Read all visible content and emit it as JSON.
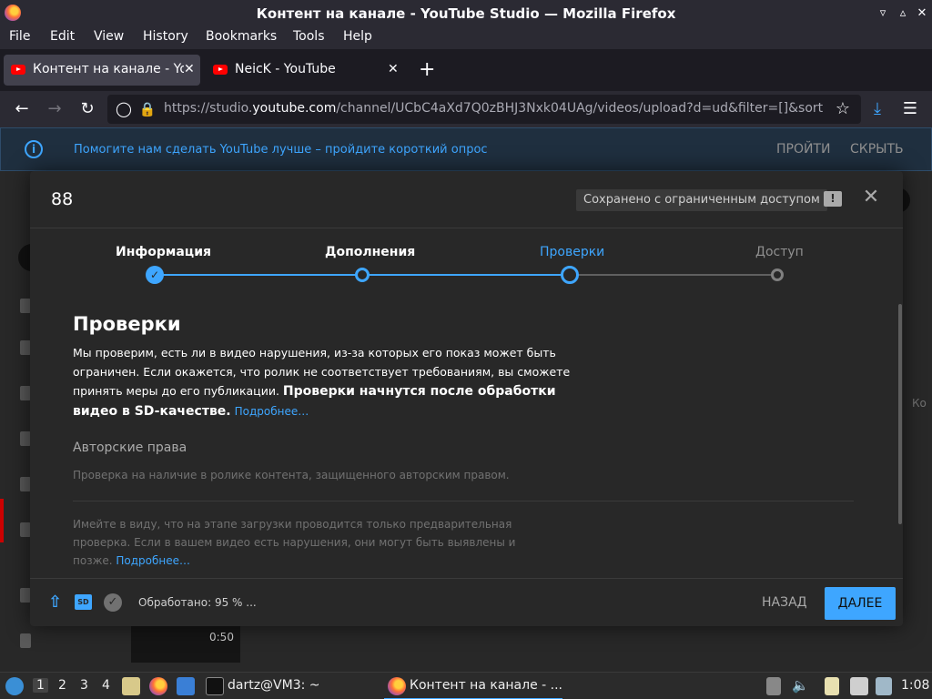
{
  "window": {
    "title": "Контент на канале - YouTube Studio — Mozilla Firefox"
  },
  "menubar": {
    "items": [
      "File",
      "Edit",
      "View",
      "History",
      "Bookmarks",
      "Tools",
      "Help"
    ]
  },
  "tabs": [
    {
      "label": "Контент на канале - You",
      "active": true
    },
    {
      "label": "NeicK - YouTube",
      "active": false
    }
  ],
  "navbar": {
    "url_prefix": "https://studio.",
    "url_host": "youtube.com",
    "url_rest": "/channel/UCbC4aXd7Q0zBHJ3Nxk04UAg/videos/upload?d=ud&filter=[]&sort"
  },
  "banner": {
    "text": "Помогите нам сделать YouTube лучше – пройдите короткий опрос",
    "go": "ПРОЙТИ",
    "hide": "СКРЫТЬ"
  },
  "dialog": {
    "title": "88",
    "saved_badge": "Сохранено с ограниченным доступом",
    "steps": [
      {
        "label": "Информация",
        "state": "done"
      },
      {
        "label": "Дополнения",
        "state": "done"
      },
      {
        "label": "Проверки",
        "state": "current"
      },
      {
        "label": "Доступ",
        "state": "pending"
      }
    ],
    "heading": "Проверки",
    "para_normal": "Мы проверим, есть ли в видео нарушения, из-за которых его показ может быть ограничен. Если окажется, что ролик не соответствует требованиям, вы сможете принять меры до его публикации. ",
    "para_bold": "Проверки начнутся после обработки видео в SD-качестве.",
    "para_link": "Подробнее…",
    "copyright_title": "Авторские права",
    "copyright_desc": "Проверка на наличие в ролике контента, защищенного авторским правом.",
    "note_text": "Имейте в виду, что на этапе загрузки проводится только предварительная проверка. Если в вашем видео есть нарушения, они могут быть выявлены и позже. ",
    "note_link": "Подробнее…",
    "footer_status": "Обработано: 95 % ...",
    "back_label": "НАЗАД",
    "next_label": "ДАЛЕЕ"
  },
  "background": {
    "duration": "0:50",
    "edge_text": "Ко"
  },
  "taskbar": {
    "workspaces": [
      "1",
      "2",
      "3",
      "4"
    ],
    "terminal_label": "dartz@VM3: ~",
    "firefox_task": "Контент на канале - ...",
    "clock": "1:08"
  },
  "colors": {
    "accent": "#3ea6ff",
    "dialog_bg": "#282828",
    "browser_chrome": "#2b2a33"
  }
}
